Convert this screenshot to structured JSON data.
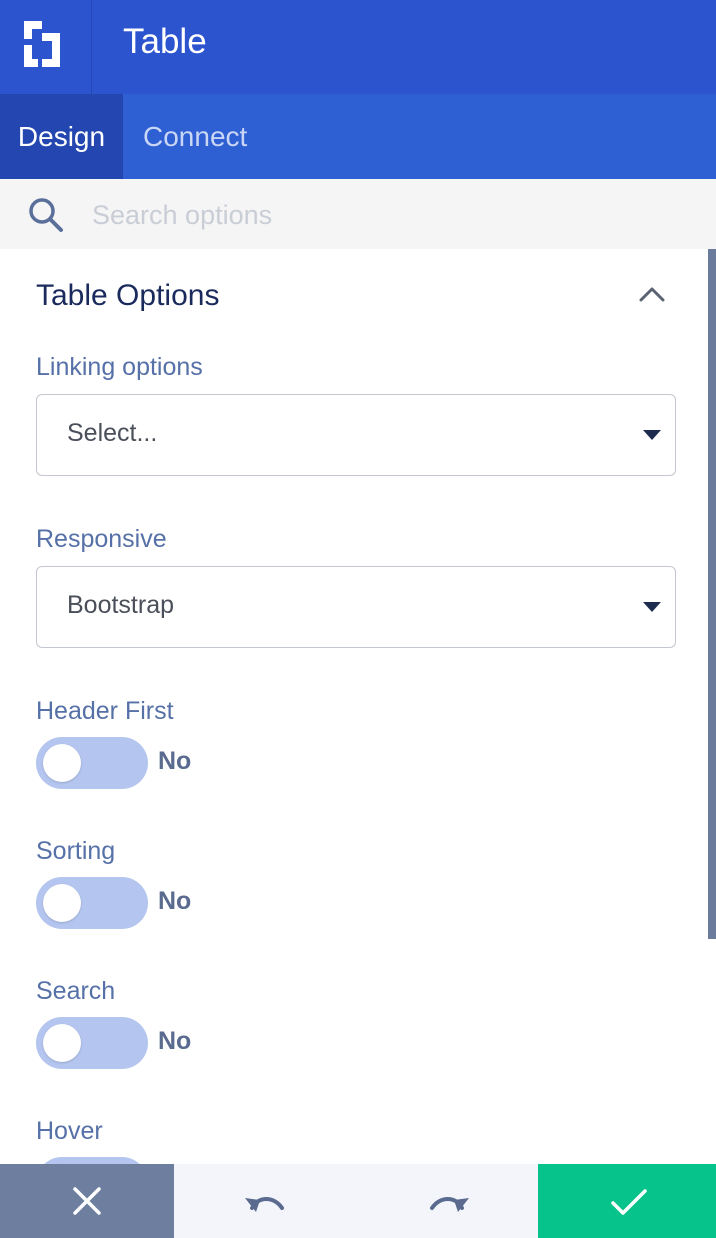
{
  "header": {
    "title": "Table",
    "logo_icon": "builder-logo-icon"
  },
  "tabs": [
    {
      "label": "Design",
      "active": true
    },
    {
      "label": "Connect",
      "active": false
    }
  ],
  "search": {
    "placeholder": "Search options",
    "value": ""
  },
  "section": {
    "title": "Table Options",
    "fields": {
      "linking": {
        "label": "Linking options",
        "value": "Select..."
      },
      "responsive": {
        "label": "Responsive",
        "value": "Bootstrap"
      },
      "header_first": {
        "label": "Header First",
        "state": "No"
      },
      "sorting": {
        "label": "Sorting",
        "state": "No"
      },
      "search": {
        "label": "Search",
        "state": "No"
      },
      "hover": {
        "label": "Hover"
      }
    }
  },
  "colors": {
    "header": "#2d54cf",
    "tabs": "#2f60d3",
    "active_tab": "#2346b0",
    "toggle_off": "#b4c5ef",
    "cancel": "#6d7e9f",
    "confirm": "#05c38a"
  },
  "footer": {
    "cancel_icon": "close-icon",
    "undo_icon": "undo-icon",
    "redo_icon": "redo-icon",
    "confirm_icon": "check-icon"
  }
}
